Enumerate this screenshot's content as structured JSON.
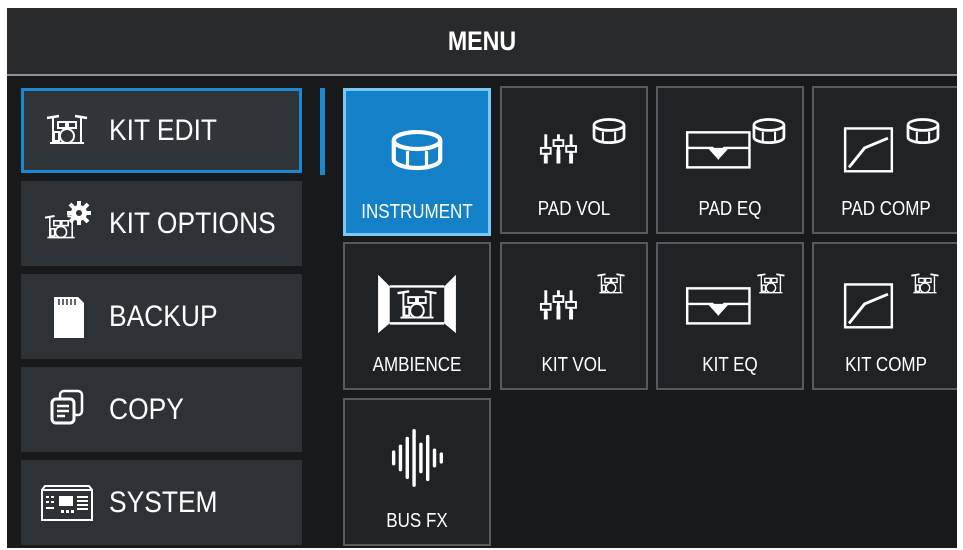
{
  "header": {
    "title": "MENU"
  },
  "sidebar": {
    "items": [
      {
        "label": "KIT EDIT",
        "icon": "drum-kit-icon",
        "selected": true
      },
      {
        "label": "KIT OPTIONS",
        "icon": "kit-options-gear-icon",
        "selected": false
      },
      {
        "label": "BACKUP",
        "icon": "sd-card-icon",
        "selected": false
      },
      {
        "label": "COPY",
        "icon": "copy-icon",
        "selected": false
      },
      {
        "label": "SYSTEM",
        "icon": "module-device-icon",
        "selected": false
      }
    ]
  },
  "grid": {
    "tiles": [
      {
        "label": "INSTRUMENT",
        "icon": "snare-drum-icon",
        "selected": true
      },
      {
        "label": "PAD VOL",
        "icon": "pad-volume-faders-icon",
        "selected": false
      },
      {
        "label": "PAD EQ",
        "icon": "pad-eq-curve-icon",
        "selected": false
      },
      {
        "label": "PAD COMP",
        "icon": "pad-compressor-curve-icon",
        "selected": false
      },
      {
        "label": "AMBIENCE",
        "icon": "room-ambience-icon",
        "selected": false
      },
      {
        "label": "KIT VOL",
        "icon": "kit-volume-faders-icon",
        "selected": false
      },
      {
        "label": "KIT EQ",
        "icon": "kit-eq-curve-icon",
        "selected": false
      },
      {
        "label": "KIT COMP",
        "icon": "kit-compressor-curve-icon",
        "selected": false
      },
      {
        "label": "BUS FX",
        "icon": "waveform-icon",
        "selected": false
      }
    ]
  },
  "colors": {
    "accent": "#1c88cf",
    "selected_tile": "#1380c8",
    "background": "#17191b",
    "sidebar_item": "#2c3235",
    "text": "#ffffff"
  }
}
